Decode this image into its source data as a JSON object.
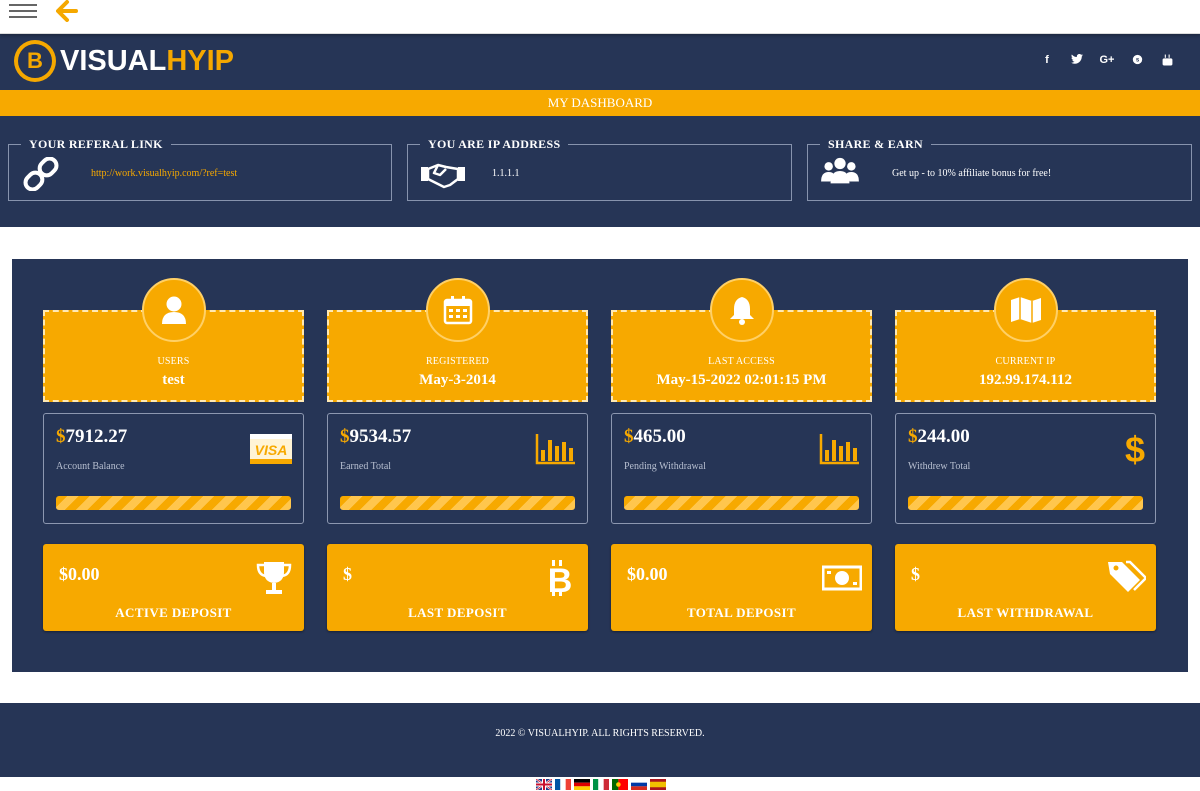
{
  "header": {
    "logo_white": "VISUAL",
    "logo_yellow": "HYIP",
    "logo_coin": "B",
    "social": [
      "f",
      "t",
      "G+",
      "s",
      "y"
    ]
  },
  "title_bar": "MY DASHBOARD",
  "info": [
    {
      "title": "YOUR REFERAL LINK",
      "icon": "link-icon",
      "text": "http://work.visualhyip.com/?ref=test"
    },
    {
      "title": "YOU ARE IP ADDRESS",
      "icon": "handshake-icon",
      "text": "1.1.1.1"
    },
    {
      "title": "SHARE & EARN",
      "icon": "users-group-icon",
      "text": "Get up - to 10% affiliate bonus for free!"
    }
  ],
  "stats": [
    {
      "label": "USERS",
      "value": "test",
      "icon": "user-icon"
    },
    {
      "label": "REGISTERED",
      "value": "May-3-2014",
      "icon": "calendar-icon"
    },
    {
      "label": "LAST ACCESS",
      "value": "May-15-2022 02:01:15 PM",
      "icon": "bell-icon"
    },
    {
      "label": "CURRENT IP",
      "value": "192.99.174.112",
      "icon": "map-icon"
    }
  ],
  "balances": [
    {
      "currency": "$",
      "amount": "7912.27",
      "label": "Account Balance",
      "icon": "visa-icon"
    },
    {
      "currency": "$",
      "amount": "9534.57",
      "label": "Earned Total",
      "icon": "bar-chart-icon"
    },
    {
      "currency": "$",
      "amount": "465.00",
      "label": "Pending Withdrawal",
      "icon": "bar-chart-icon"
    },
    {
      "currency": "$",
      "amount": "244.00",
      "label": "Withdrew Total",
      "icon": "dollar-icon"
    }
  ],
  "deposits": [
    {
      "amount": "$0.00",
      "label": "ACTIVE DEPOSIT",
      "icon": "trophy-icon"
    },
    {
      "amount": "$",
      "label": "LAST DEPOSIT",
      "icon": "bitcoin-icon"
    },
    {
      "amount": "$0.00",
      "label": "TOTAL DEPOSIT",
      "icon": "money-icon"
    },
    {
      "amount": "$",
      "label": "LAST WITHDRAWAL",
      "icon": "tags-icon"
    }
  ],
  "footer": "2022 © VISUALHYIP. ALL RIGHTS RESERVED.",
  "languages": [
    "english-flag",
    "french-flag",
    "german-flag",
    "italian-flag",
    "portuguese-flag",
    "russian-flag",
    "spanish-flag"
  ],
  "colors": {
    "navy": "#263556",
    "accent": "#f7a900"
  }
}
